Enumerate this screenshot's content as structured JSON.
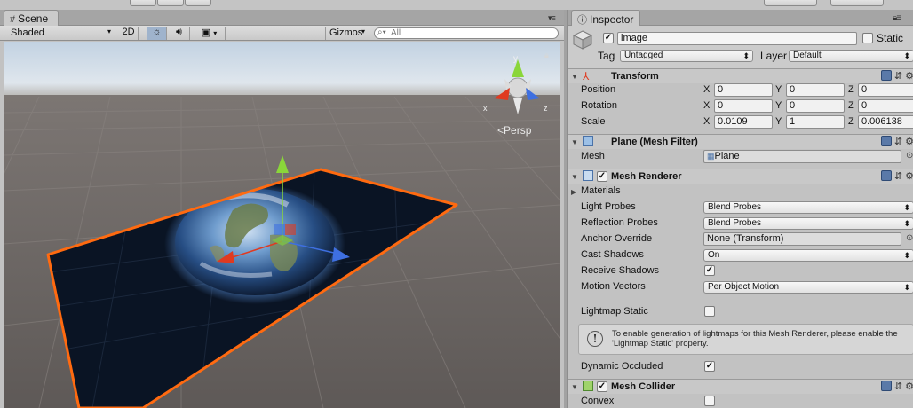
{
  "scene_tab": {
    "title": "Scene",
    "icon": "scene-grid-icon"
  },
  "scene_toolbar": {
    "shading_mode": "Shaded",
    "mode_2d": "2D",
    "gizmos_label": "Gizmos",
    "search_placeholder": "All"
  },
  "viewport": {
    "projection_label": "Persp",
    "axis_x": "x",
    "axis_z": "z",
    "selection_color": "#ff6a10",
    "axis_colors": {
      "x": "#e03a20",
      "y": "#8ad63a",
      "z": "#3e6fe0"
    }
  },
  "inspector_tab": {
    "title": "Inspector",
    "icon": "info-icon"
  },
  "gameobject": {
    "active": true,
    "name": "image",
    "static_label": "Static",
    "static": false,
    "tag_label": "Tag",
    "tag_value": "Untagged",
    "layer_label": "Layer",
    "layer_value": "Default"
  },
  "transform": {
    "title": "Transform",
    "position": {
      "label": "Position",
      "x": "0",
      "y": "0",
      "z": "0"
    },
    "rotation": {
      "label": "Rotation",
      "x": "0",
      "y": "0",
      "z": "0"
    },
    "scale": {
      "label": "Scale",
      "x": "0.0109",
      "y": "1",
      "z": "0.006138"
    },
    "axis_x": "X",
    "axis_y": "Y",
    "axis_z": "Z"
  },
  "mesh_filter": {
    "title": "Plane (Mesh Filter)",
    "mesh_label": "Mesh",
    "mesh_value": "Plane"
  },
  "mesh_renderer": {
    "title": "Mesh Renderer",
    "enabled": true,
    "materials_label": "Materials",
    "light_probes_label": "Light Probes",
    "light_probes_value": "Blend Probes",
    "reflection_probes_label": "Reflection Probes",
    "reflection_probes_value": "Blend Probes",
    "anchor_override_label": "Anchor Override",
    "anchor_override_value": "None (Transform)",
    "cast_shadows_label": "Cast Shadows",
    "cast_shadows_value": "On",
    "receive_shadows_label": "Receive Shadows",
    "receive_shadows": true,
    "motion_vectors_label": "Motion Vectors",
    "motion_vectors_value": "Per Object Motion",
    "lightmap_static_label": "Lightmap Static",
    "lightmap_static": false,
    "help_text": "To enable generation of lightmaps for this Mesh Renderer, please enable the 'Lightmap Static' property.",
    "dynamic_occluded_label": "Dynamic Occluded",
    "dynamic_occluded": true
  },
  "mesh_collider": {
    "title": "Mesh Collider",
    "enabled": true,
    "convex_label": "Convex",
    "convex": false
  }
}
